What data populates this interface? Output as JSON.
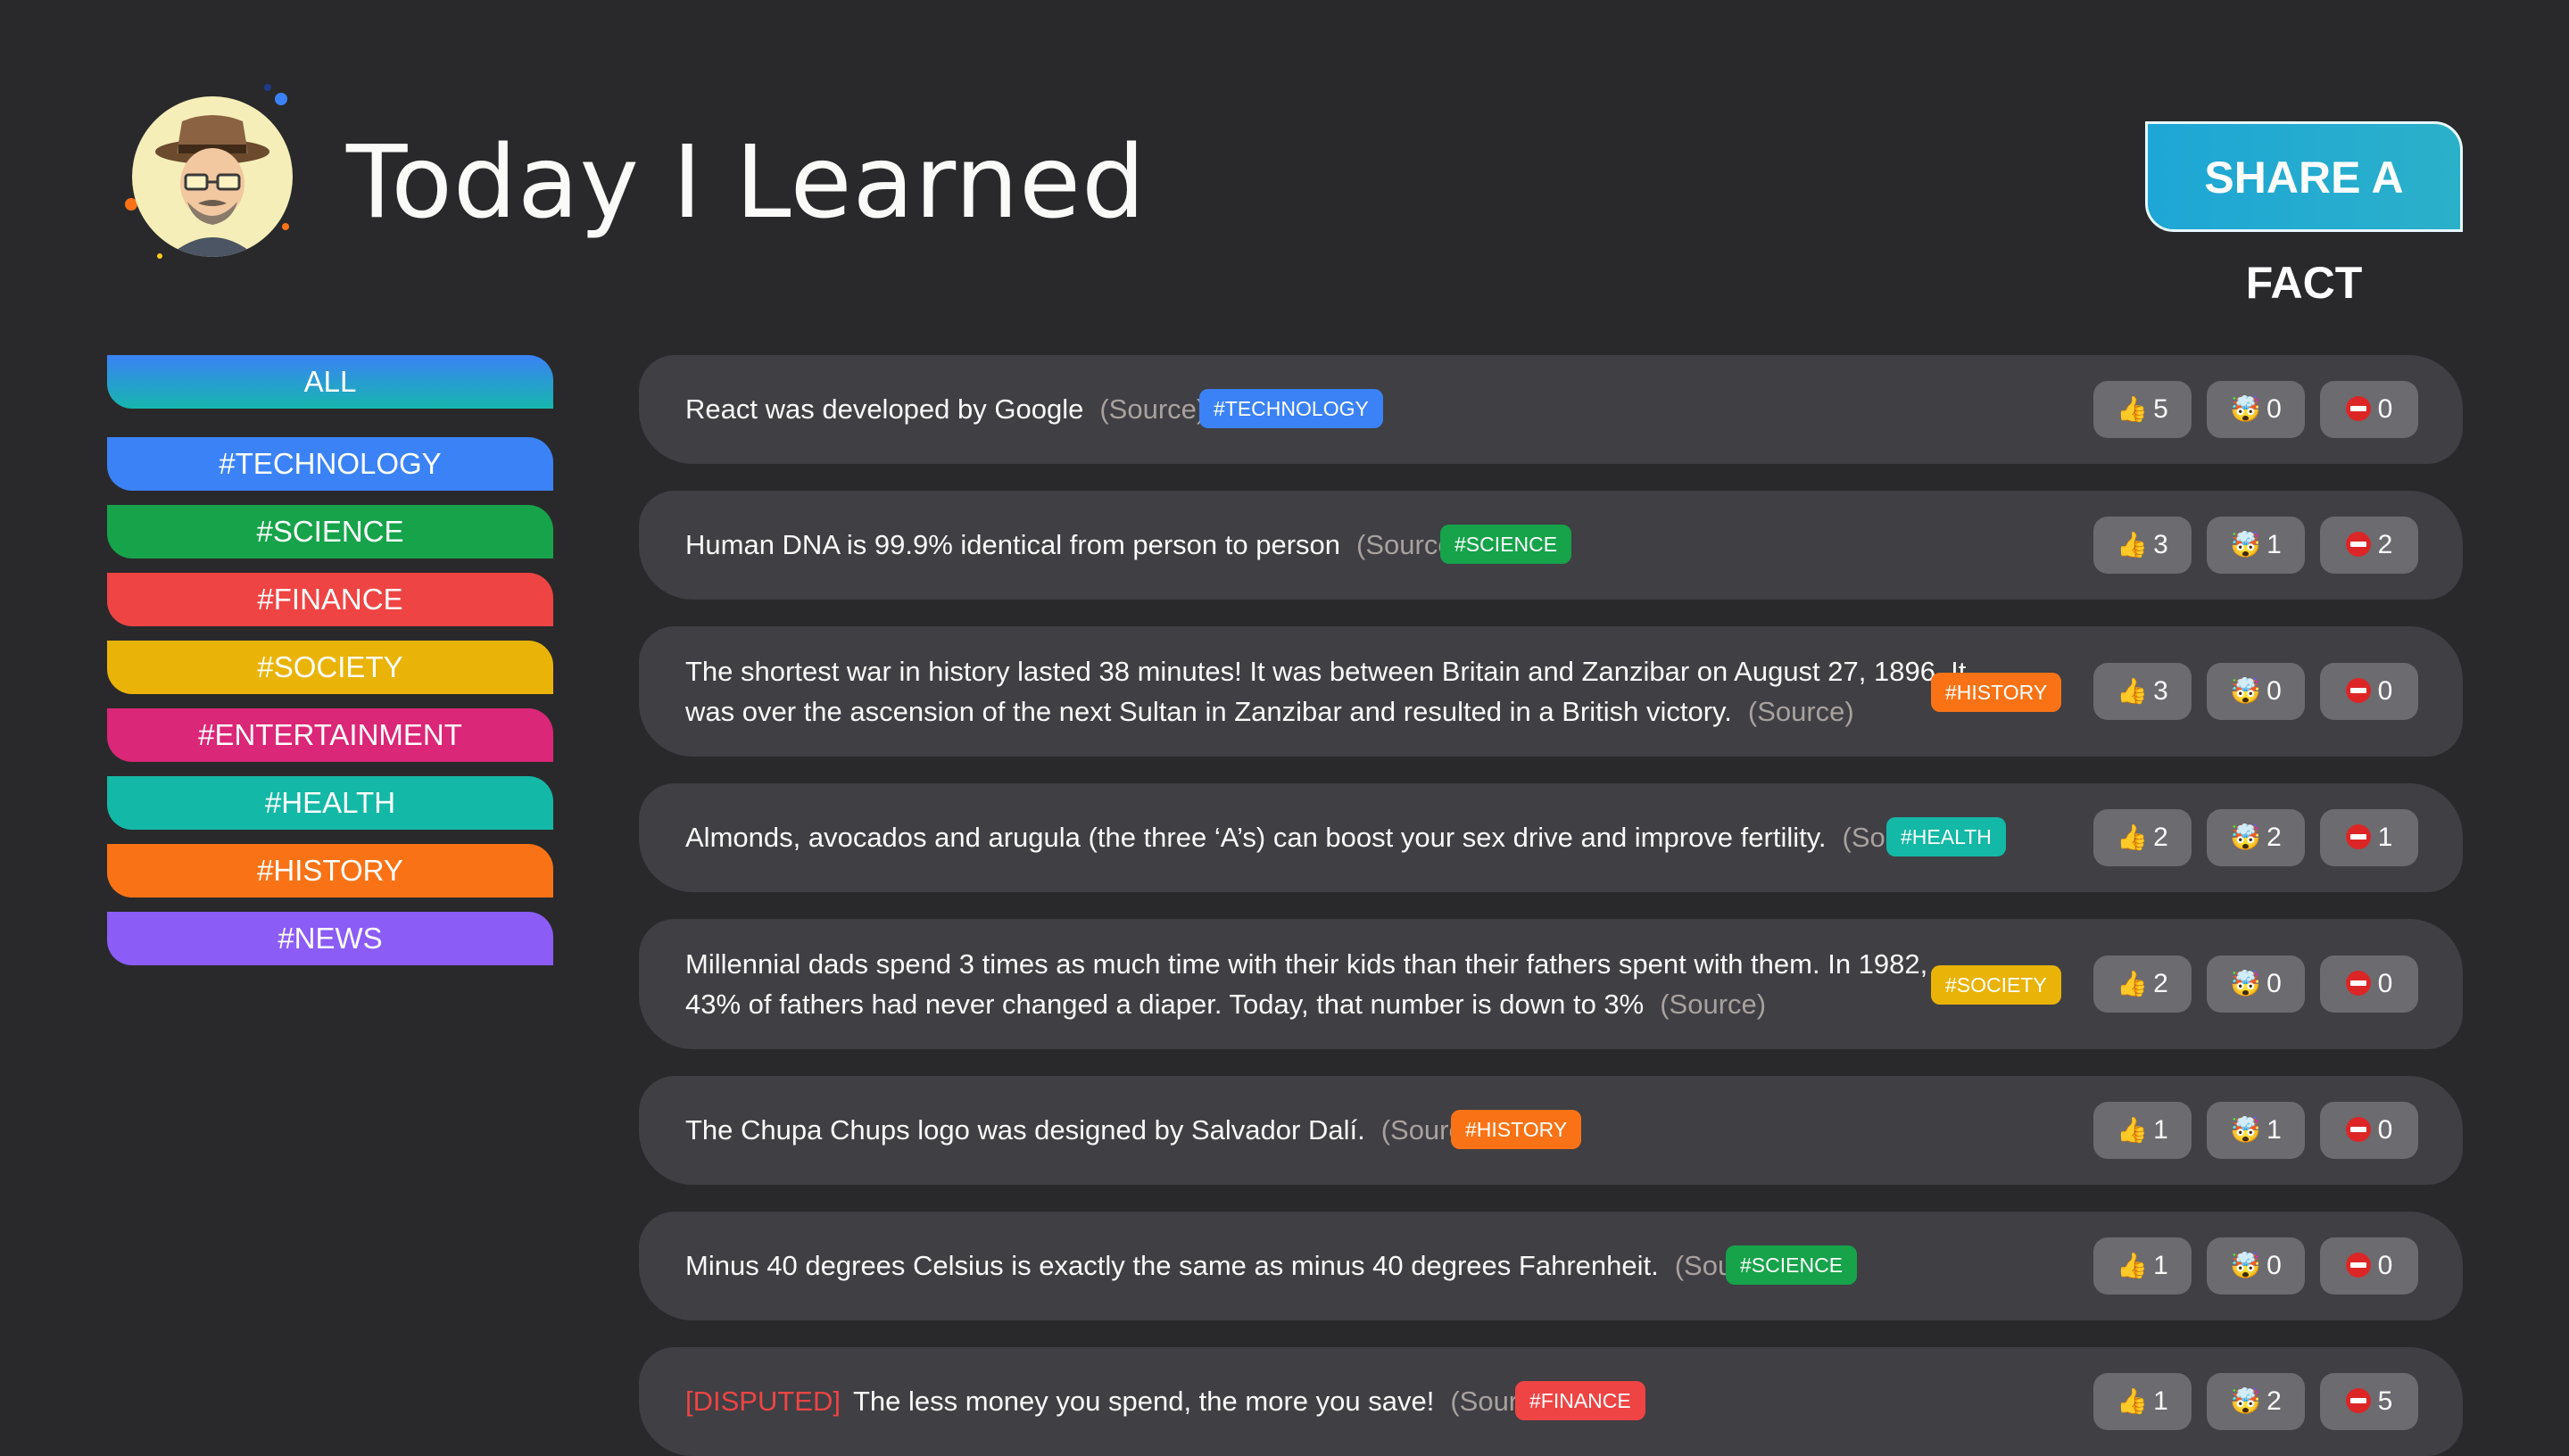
{
  "header": {
    "title": "Today I Learned",
    "share_label": "SHARE A FACT"
  },
  "sidebar": {
    "items": [
      {
        "label": "ALL",
        "color": "#2bb0c9"
      },
      {
        "label": "#TECHNOLOGY",
        "color": "#3b82f6"
      },
      {
        "label": "#SCIENCE",
        "color": "#16a34a"
      },
      {
        "label": "#FINANCE",
        "color": "#ef4444"
      },
      {
        "label": "#SOCIETY",
        "color": "#eab308"
      },
      {
        "label": "#ENTERTAINMENT",
        "color": "#db2777"
      },
      {
        "label": "#HEALTH",
        "color": "#14b8a6"
      },
      {
        "label": "#HISTORY",
        "color": "#f97316"
      },
      {
        "label": "#NEWS",
        "color": "#8b5cf6"
      }
    ]
  },
  "facts": [
    {
      "text": "React was developed by Google",
      "source": "(Source)",
      "tag": "#TECHNOLOGY",
      "tag_color": "#3b82f6",
      "votes": {
        "interesting": "5",
        "mindblowing": "0",
        "false": "0"
      }
    },
    {
      "text": "Human DNA is 99.9% identical from person to person",
      "source": "(Source)",
      "tag": "#SCIENCE",
      "tag_color": "#16a34a",
      "votes": {
        "interesting": "3",
        "mindblowing": "1",
        "false": "2"
      }
    },
    {
      "text": "The shortest war in history lasted 38 minutes! It was between Britain and Zanzibar on August 27, 1896. It",
      "text2": "was over the ascension of the next Sultan in Zanzibar and resulted in a British victory.",
      "source": "(Source)",
      "tag": "#HISTORY",
      "tag_color": "#f97316",
      "votes": {
        "interesting": "3",
        "mindblowing": "0",
        "false": "0"
      }
    },
    {
      "text": "Almonds, avocados and arugula (the three ‘A’s) can boost your sex drive and improve fertility.",
      "source": "(Source)",
      "tag": "#HEALTH",
      "tag_color": "#14b8a6",
      "votes": {
        "interesting": "2",
        "mindblowing": "2",
        "false": "1"
      }
    },
    {
      "text": "Millennial dads spend 3 times as much time with their kids than their fathers spent with them. In 1982,",
      "text2": "43% of fathers had never changed a diaper. Today, that number is down to 3%",
      "source": "(Source)",
      "tag": "#SOCIETY",
      "tag_color": "#eab308",
      "votes": {
        "interesting": "2",
        "mindblowing": "0",
        "false": "0"
      }
    },
    {
      "text": "The Chupa Chups logo was designed by Salvador Dalí.",
      "source": "(Source)",
      "tag": "#HISTORY",
      "tag_color": "#f97316",
      "votes": {
        "interesting": "1",
        "mindblowing": "1",
        "false": "0"
      }
    },
    {
      "text": "Minus 40 degrees Celsius is exactly the same as minus 40 degrees Fahrenheit.",
      "source": "(Source)",
      "tag": "#SCIENCE",
      "tag_color": "#16a34a",
      "votes": {
        "interesting": "1",
        "mindblowing": "0",
        "false": "0"
      }
    },
    {
      "disputed": "[DISPUTED]",
      "text": "The less money you spend, the more you save!",
      "source": "(Source)",
      "tag": "#FINANCE",
      "tag_color": "#ef4444",
      "votes": {
        "interesting": "1",
        "mindblowing": "2",
        "false": "5"
      }
    }
  ],
  "icons": {
    "interesting": "thumbs-up-icon",
    "mindblowing": "mind-blown-icon",
    "false": "no-entry-icon"
  },
  "colors": {
    "background": "#29292b",
    "card": "#3f3f44",
    "vote_button": "#6b6b70",
    "source_text": "#a8a29e",
    "disputed": "#ef4444"
  }
}
